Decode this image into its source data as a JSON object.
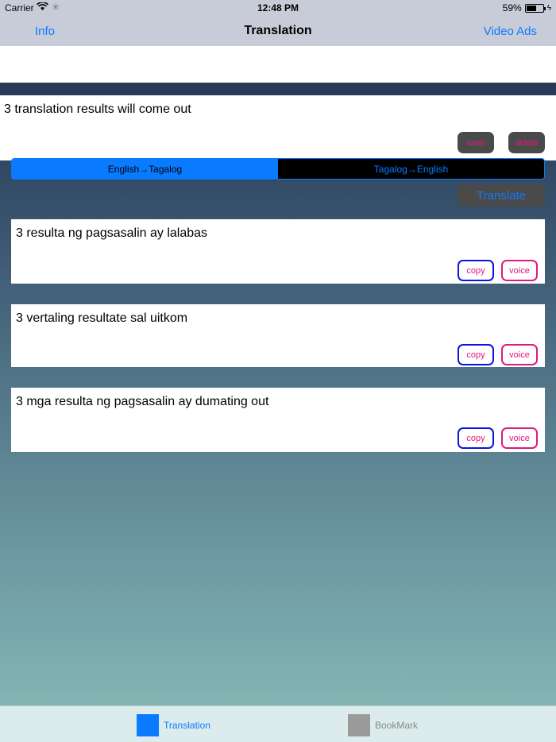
{
  "status_bar": {
    "carrier": "Carrier",
    "wifi_icon": "wifi-icon",
    "time": "12:48 PM",
    "battery": "59%",
    "battery_level": 0.59
  },
  "nav": {
    "left": "Info",
    "title": "Translation",
    "right": "Video Ads"
  },
  "input": {
    "text": "3 translation results will come out",
    "save_label": "save",
    "delete_label": "delete"
  },
  "segmented": {
    "options": [
      "English→Tagalog",
      "Tagalog→English"
    ],
    "selected": "English→Tagalog"
  },
  "translate_label": "Translate",
  "results": [
    {
      "text": "3 resulta ng pagsasalin ay lalabas",
      "copy_label": "copy",
      "voice_label": "voice"
    },
    {
      "text": "3 vertaling resultate sal uitkom",
      "copy_label": "copy",
      "voice_label": "voice"
    },
    {
      "text": "3 mga resulta ng pagsasalin ay dumating out",
      "copy_label": "copy",
      "voice_label": "voice"
    }
  ],
  "tabs": [
    {
      "label": "Translation",
      "active": true
    },
    {
      "label": "BookMark",
      "active": false
    }
  ],
  "colors": {
    "accent": "#0a7aff",
    "pink": "#e0187f",
    "copy_border": "#0a14e0",
    "dark_button": "#4a4a4a"
  }
}
